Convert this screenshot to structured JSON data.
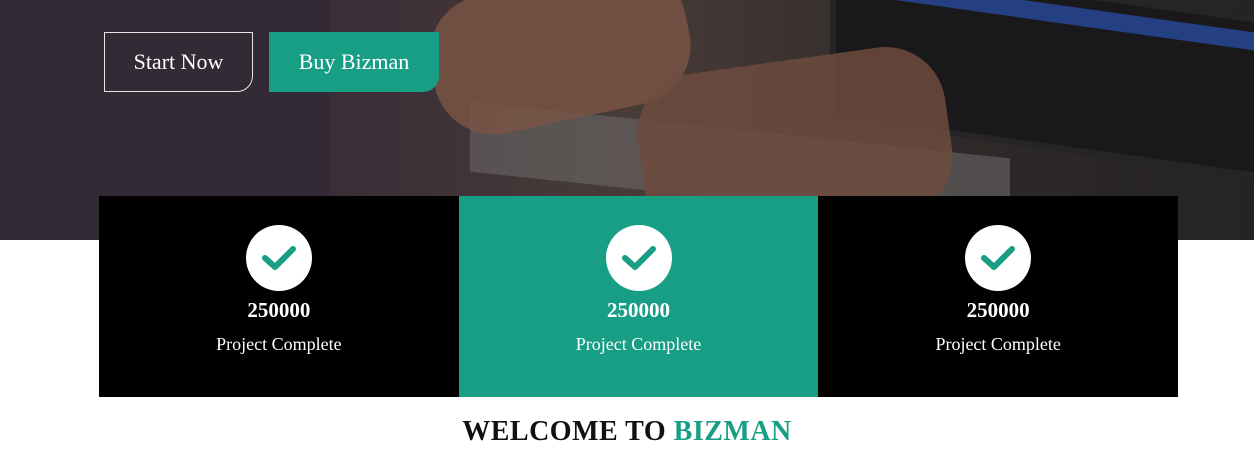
{
  "hero": {
    "start_label": "Start Now",
    "buy_label": "Buy Bizman"
  },
  "stats": [
    {
      "value": "250000",
      "label": "Project Complete",
      "icon": "check-icon"
    },
    {
      "value": "250000",
      "label": "Project Complete",
      "icon": "check-icon"
    },
    {
      "value": "250000",
      "label": "Project Complete",
      "icon": "check-icon"
    }
  ],
  "welcome": {
    "prefix": "WELCOME TO",
    "brand": "BIZMAN"
  },
  "colors": {
    "accent": "#189e84",
    "dark": "#000000",
    "text_light": "#ffffff"
  }
}
